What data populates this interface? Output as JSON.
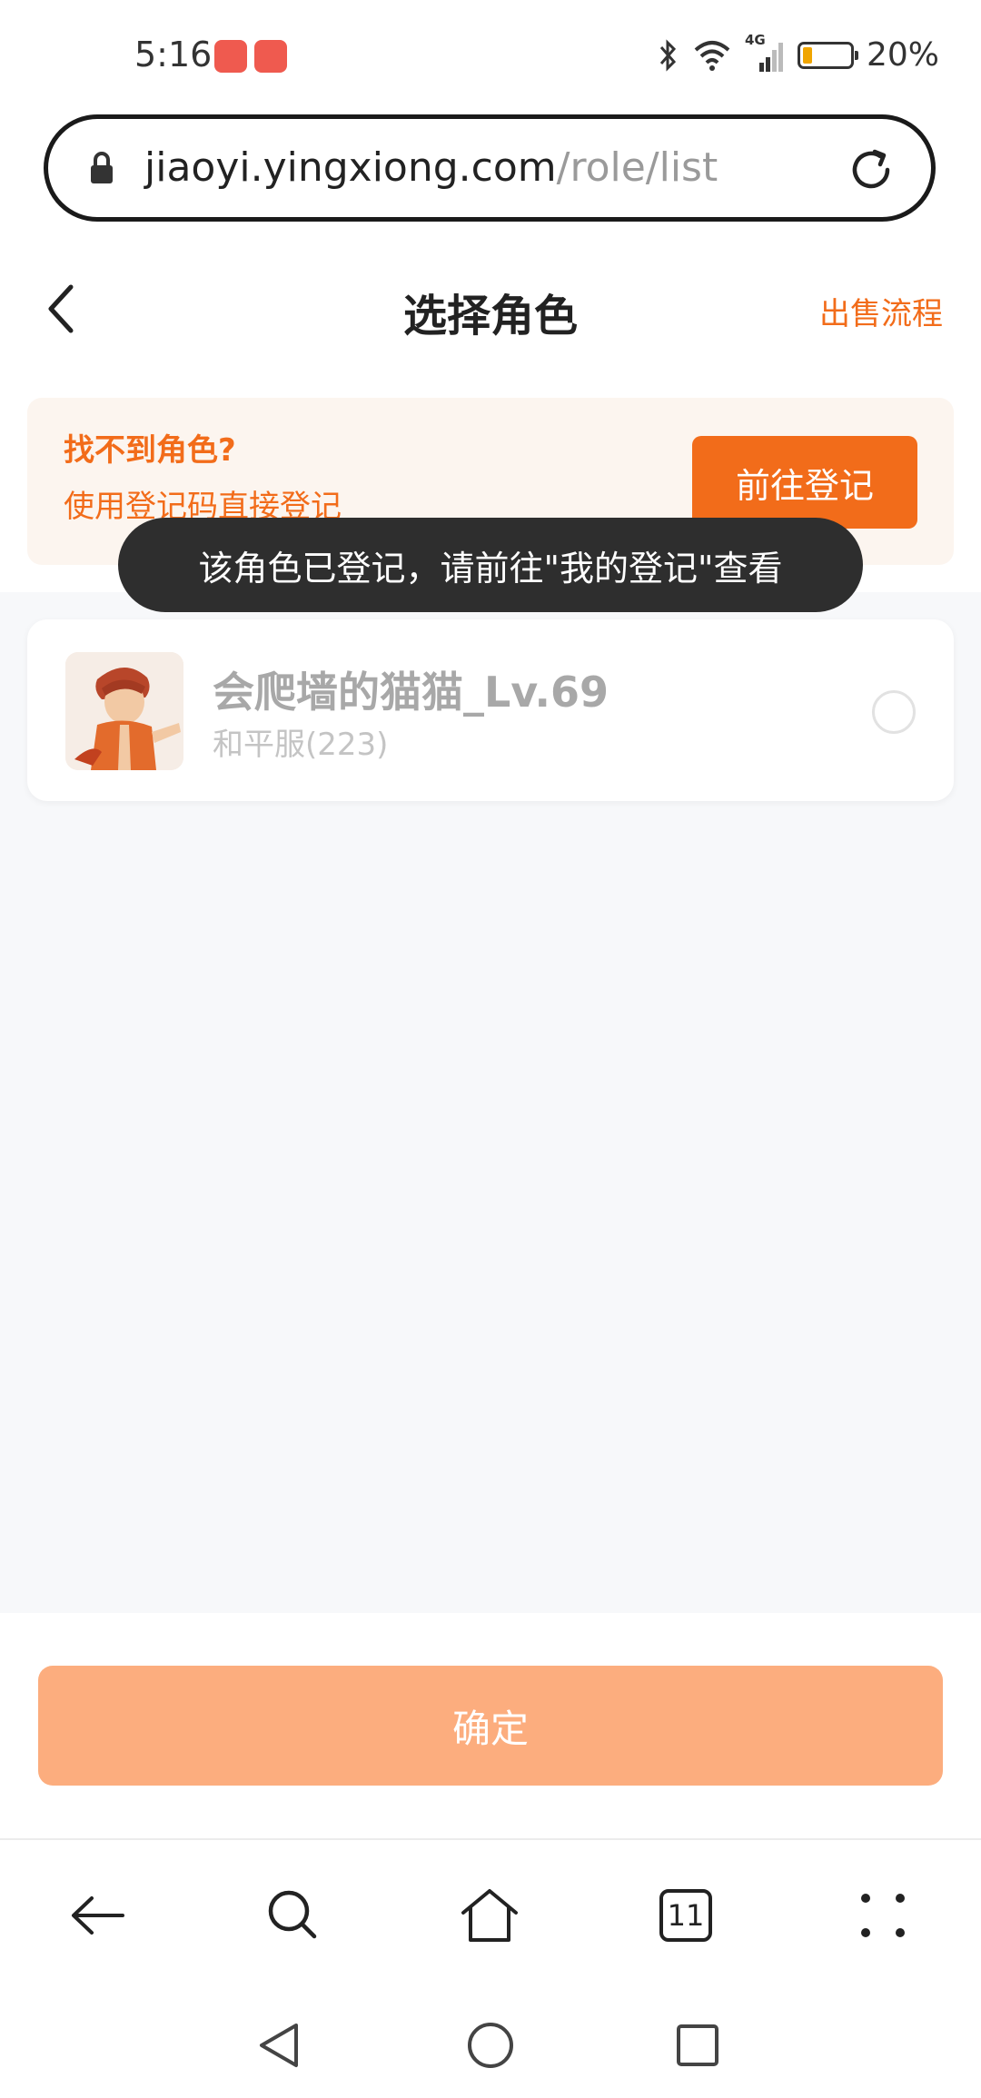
{
  "status_bar": {
    "time": "5:16",
    "network": "4G",
    "battery_percent_text": "20%",
    "battery_level": 0.2,
    "notification_icons": [
      "huawei-appgallery-icon",
      "huawei-appgallery-icon"
    ],
    "indicator_icons": [
      "bluetooth-icon",
      "wifi-icon",
      "cellular-signal-icon",
      "battery-icon"
    ]
  },
  "browser": {
    "url_domain": "jiaoyi.yingxiong.com",
    "url_path": "/role/list"
  },
  "header": {
    "title": "选择角色",
    "right_link": "出售流程"
  },
  "banner": {
    "title": "找不到角色?",
    "subtitle": "使用登记码直接登记",
    "button_label": "前往登记"
  },
  "roles": [
    {
      "name": "会爬墙的猫猫_Lv.69",
      "server": "和平服(223)",
      "selected": false
    }
  ],
  "toast": {
    "message": "该角色已登记，请前往\"我的登记\"查看"
  },
  "footer": {
    "confirm_label": "确定"
  },
  "toolbar": {
    "tab_count": "11"
  },
  "colors": {
    "accent": "#f26c1a",
    "confirm_disabled": "#fcad7e",
    "banner_bg": "#fcf5ef"
  }
}
